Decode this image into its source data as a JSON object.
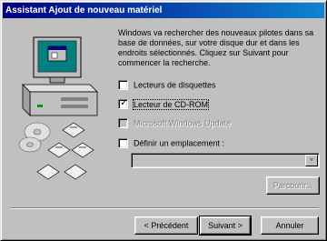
{
  "window": {
    "title": "Assistant Ajout de nouveau matériel"
  },
  "description": "Windows va rechercher des nouveaux pilotes dans sa base de données, sur votre disque dur et dans les endroits sélectionnés. Cliquez sur Suivant pour commencer la recherche.",
  "options": [
    {
      "label": "Lecteurs de disquettes",
      "checked": false,
      "enabled": true
    },
    {
      "label": "Lecteur de CD-ROM",
      "checked": true,
      "enabled": true
    },
    {
      "label": "Microsoft Windows Update",
      "checked": false,
      "enabled": false
    },
    {
      "label": "Définir un emplacement :",
      "checked": false,
      "enabled": true
    }
  ],
  "location": {
    "value": ""
  },
  "buttons": {
    "browse": "Parcourir...",
    "back": "< Précédent",
    "next": "Suivant >",
    "cancel": "Annuler"
  },
  "icons": {
    "illustration": "computer-with-cd-discs-illustration"
  },
  "colors": {
    "titlebar_start": "#000080",
    "titlebar_end": "#1084d0",
    "face": "#c0c0c0"
  }
}
